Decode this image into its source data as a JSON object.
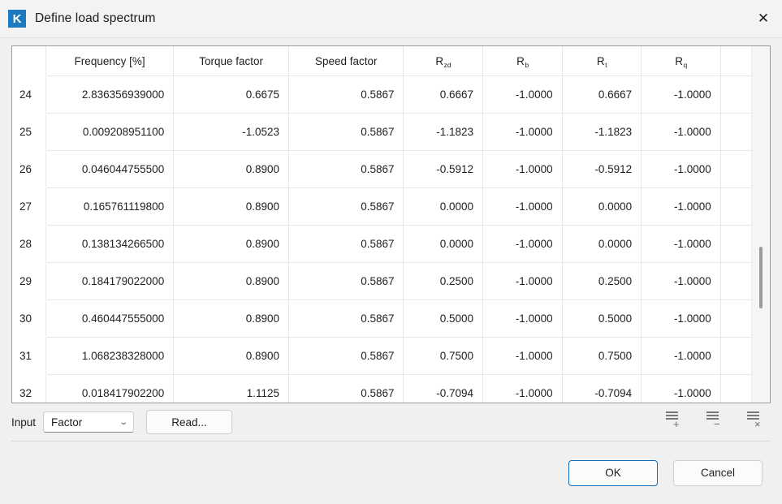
{
  "window": {
    "title": "Define load spectrum",
    "app_icon_letter": "K",
    "close_icon": "close-icon",
    "accent_color": "#0f6cbd",
    "icon_bg_color": "#1e7ac0"
  },
  "table": {
    "columns": [
      {
        "key": "index",
        "label": ""
      },
      {
        "key": "frequency",
        "label": "Frequency [%]"
      },
      {
        "key": "torque_factor",
        "label": "Torque factor"
      },
      {
        "key": "speed_factor",
        "label": "Speed factor"
      },
      {
        "key": "r_zd",
        "label": "R",
        "sub": "zd"
      },
      {
        "key": "r_b",
        "label": "R",
        "sub": "b"
      },
      {
        "key": "r_t",
        "label": "R",
        "sub": "t"
      },
      {
        "key": "r_q",
        "label": "R",
        "sub": "q"
      }
    ],
    "rows": [
      {
        "index": "24",
        "frequency": "2.836356939000",
        "torque_factor": "0.6675",
        "speed_factor": "0.5867",
        "r_zd": "0.6667",
        "r_b": "-1.0000",
        "r_t": "0.6667",
        "r_q": "-1.0000"
      },
      {
        "index": "25",
        "frequency": "0.009208951100",
        "torque_factor": "-1.0523",
        "speed_factor": "0.5867",
        "r_zd": "-1.1823",
        "r_b": "-1.0000",
        "r_t": "-1.1823",
        "r_q": "-1.0000"
      },
      {
        "index": "26",
        "frequency": "0.046044755500",
        "torque_factor": "0.8900",
        "speed_factor": "0.5867",
        "r_zd": "-0.5912",
        "r_b": "-1.0000",
        "r_t": "-0.5912",
        "r_q": "-1.0000"
      },
      {
        "index": "27",
        "frequency": "0.165761119800",
        "torque_factor": "0.8900",
        "speed_factor": "0.5867",
        "r_zd": "0.0000",
        "r_b": "-1.0000",
        "r_t": "0.0000",
        "r_q": "-1.0000"
      },
      {
        "index": "28",
        "frequency": "0.138134266500",
        "torque_factor": "0.8900",
        "speed_factor": "0.5867",
        "r_zd": "0.0000",
        "r_b": "-1.0000",
        "r_t": "0.0000",
        "r_q": "-1.0000"
      },
      {
        "index": "29",
        "frequency": "0.184179022000",
        "torque_factor": "0.8900",
        "speed_factor": "0.5867",
        "r_zd": "0.2500",
        "r_b": "-1.0000",
        "r_t": "0.2500",
        "r_q": "-1.0000"
      },
      {
        "index": "30",
        "frequency": "0.460447555000",
        "torque_factor": "0.8900",
        "speed_factor": "0.5867",
        "r_zd": "0.5000",
        "r_b": "-1.0000",
        "r_t": "0.5000",
        "r_q": "-1.0000"
      },
      {
        "index": "31",
        "frequency": "1.068238328000",
        "torque_factor": "0.8900",
        "speed_factor": "0.5867",
        "r_zd": "0.7500",
        "r_b": "-1.0000",
        "r_t": "0.7500",
        "r_q": "-1.0000"
      },
      {
        "index": "32",
        "frequency": "0.018417902200",
        "torque_factor": "1.1125",
        "speed_factor": "0.5867",
        "r_zd": "-0.7094",
        "r_b": "-1.0000",
        "r_t": "-0.7094",
        "r_q": "-1.0000"
      }
    ]
  },
  "toolbar": {
    "input_label": "Input",
    "input_value": "Factor",
    "input_options": [
      "Factor"
    ],
    "dropdown_icon": "chevron-down-icon",
    "read_label": "Read...",
    "row_actions": [
      {
        "name": "add-row",
        "symbol": "+"
      },
      {
        "name": "remove-row",
        "symbol": "−"
      },
      {
        "name": "delete-rows",
        "symbol": "×"
      }
    ]
  },
  "footer": {
    "ok_label": "OK",
    "cancel_label": "Cancel"
  }
}
